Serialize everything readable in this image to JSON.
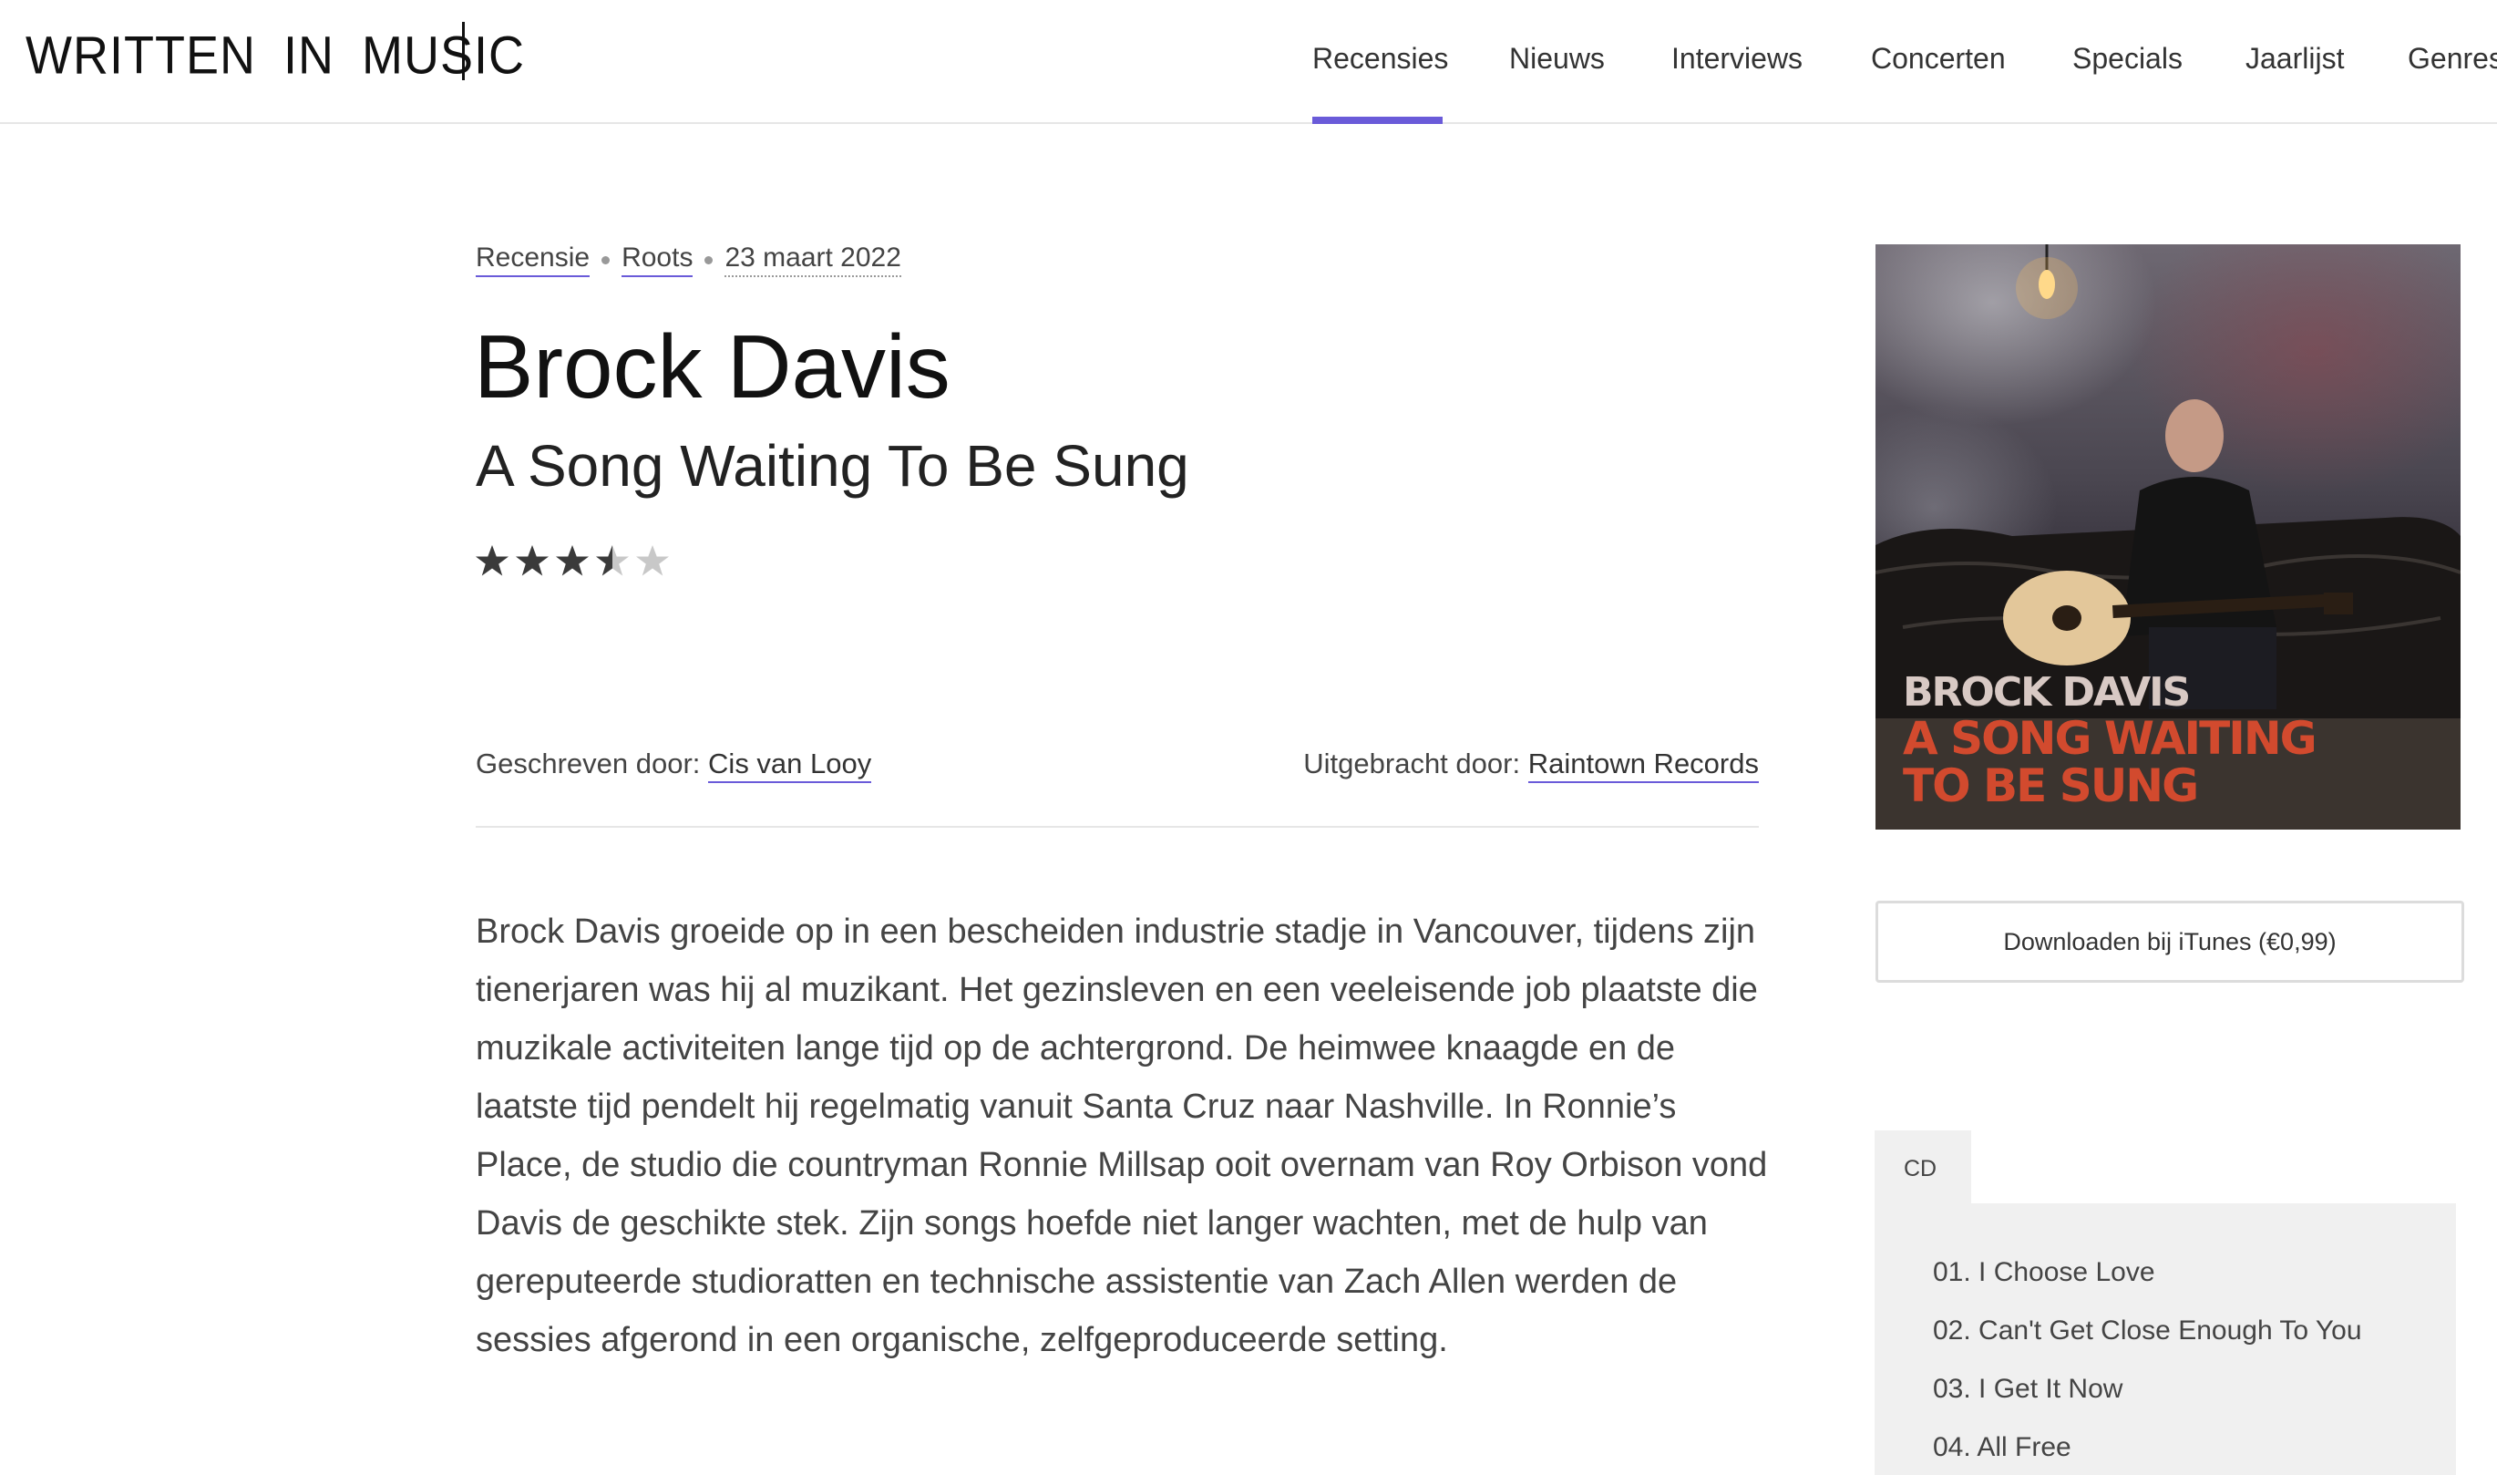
{
  "site": {
    "logo": "WRITTEN IN MUSIC",
    "nav": [
      "Recensies",
      "Nieuws",
      "Interviews",
      "Concerten",
      "Specials",
      "Jaarlijst",
      "Genres"
    ],
    "active_nav": "Recensies",
    "accent_color": "#6a5bd9"
  },
  "article": {
    "meta": {
      "type": "Recensie",
      "genre": "Roots",
      "date": "23 maart 2022"
    },
    "artist": "Brock Davis",
    "album": "A Song Waiting To Be Sung",
    "rating": {
      "value": 3.5,
      "max": 5
    },
    "author_label": "Geschreven door:",
    "author": "Cis van Looy",
    "label_label": "Uitgebracht door:",
    "label": "Raintown Records",
    "body": "Brock Davis groeide op in een bescheiden industrie stadje in Vancouver, tijdens zijn tienerjaren was hij al muzikant. Het gezinsleven en een veeleisende job plaatste die muzikale activiteiten lange tijd op de achtergrond.  De heimwee knaagde en de laatste tijd pendelt hij regelmatig vanuit Santa Cruz naar Nashville. In Ronnie’s Place, de studio die countryman Ronnie Millsap ooit overnam van Roy Orbison vond Davis de geschikte stek. Zijn songs hoefde niet langer wachten, met de hulp van gereputeerde studioratten en technische assistentie van Zach Allen werden de sessies afgerond in een organische, zelfgeproduceerde setting."
  },
  "sidebar": {
    "cover": {
      "artist_text": "BROCK DAVIS",
      "album_line1": "A SONG WAITING",
      "album_line2": "TO BE SUNG"
    },
    "itunes_button": "Downloaden bij iTunes (€0,99)",
    "format_tab": "CD",
    "tracks": [
      "01. I Choose Love",
      "02. Can't Get Close Enough To You",
      "03. I Get It Now",
      "04. All Free"
    ]
  }
}
